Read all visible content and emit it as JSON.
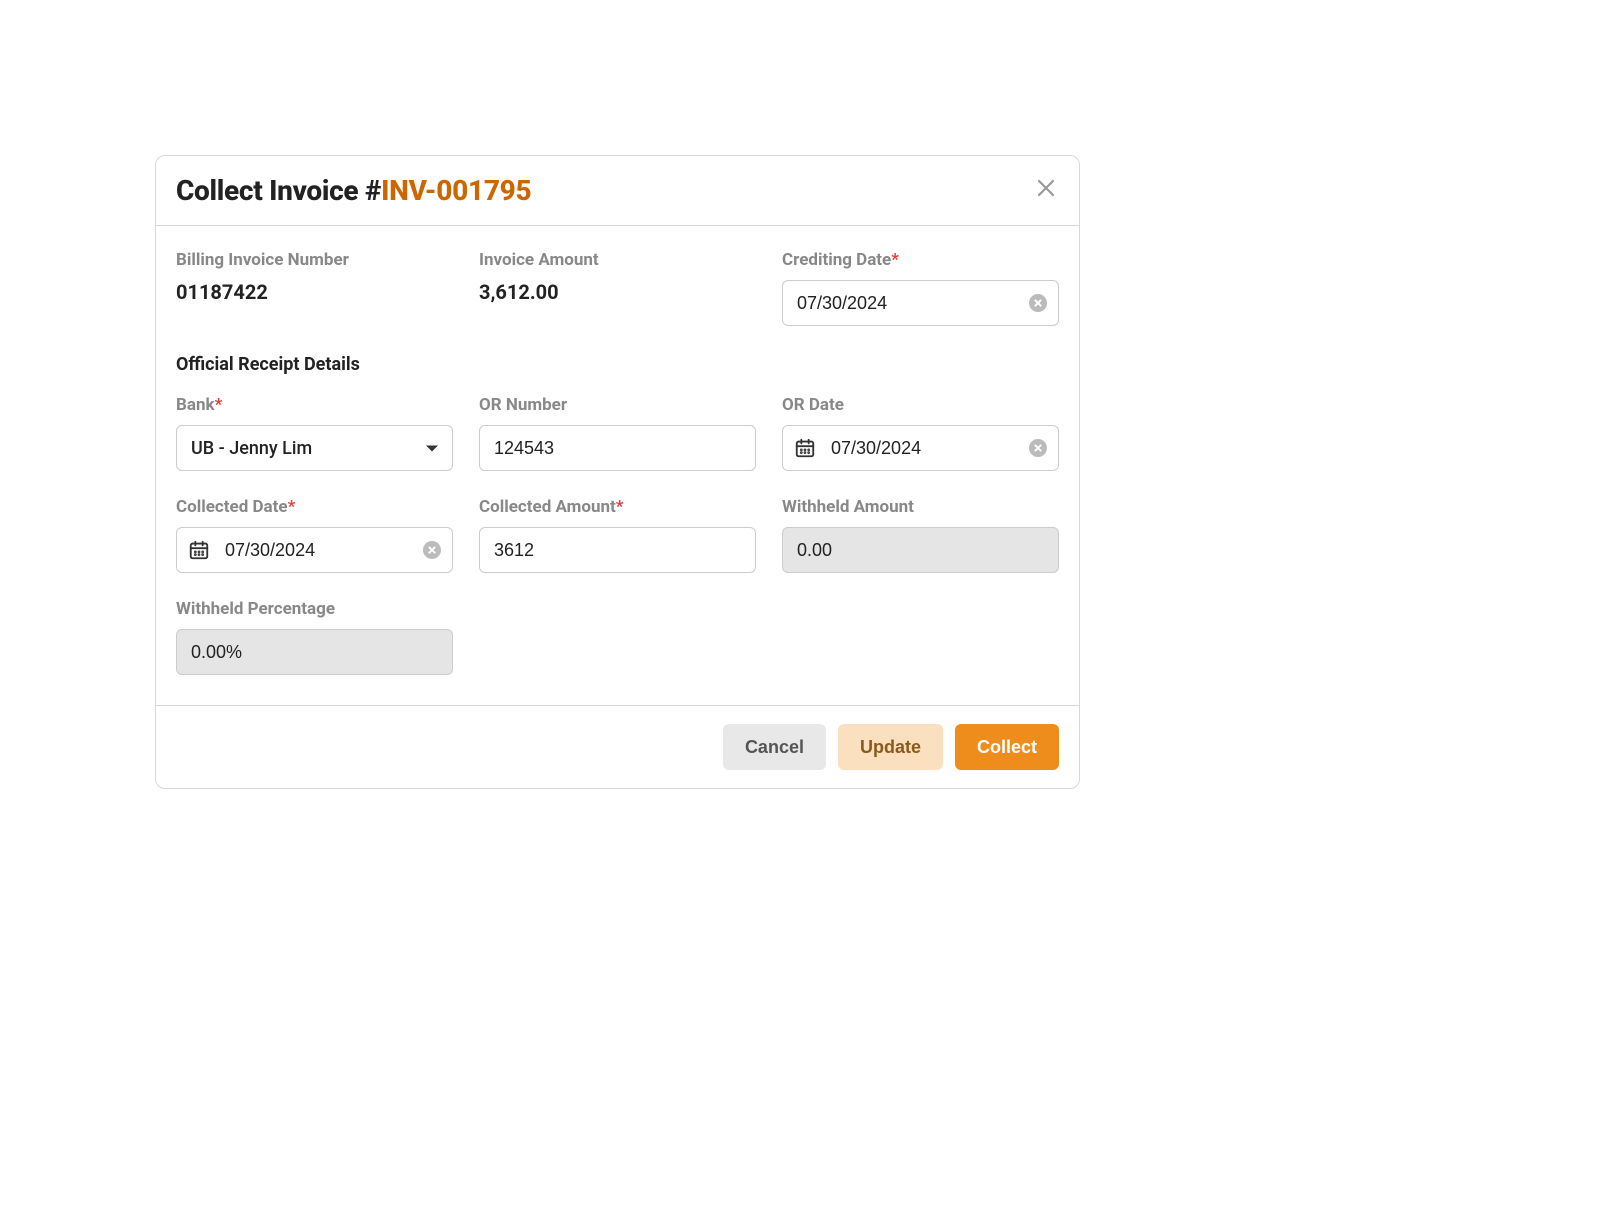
{
  "modal": {
    "title_prefix": "Collect Invoice #",
    "invoice_id": "INV-001795"
  },
  "fields": {
    "billing_invoice_number": {
      "label": "Billing Invoice Number",
      "value": "01187422"
    },
    "invoice_amount": {
      "label": "Invoice Amount",
      "value": "3,612.00"
    },
    "crediting_date": {
      "label": "Crediting Date",
      "value": "07/30/2024"
    },
    "section_or": "Official Receipt Details",
    "bank": {
      "label": "Bank",
      "value": "UB - Jenny Lim"
    },
    "or_number": {
      "label": "OR Number",
      "value": "124543"
    },
    "or_date": {
      "label": "OR Date",
      "value": "07/30/2024"
    },
    "collected_date": {
      "label": "Collected Date",
      "value": "07/30/2024"
    },
    "collected_amount": {
      "label": "Collected Amount",
      "value": "3612"
    },
    "withheld_amount": {
      "label": "Withheld Amount",
      "value": "0.00"
    },
    "withheld_percentage": {
      "label": "Withheld Percentage",
      "value": "0.00%"
    }
  },
  "buttons": {
    "cancel": "Cancel",
    "update": "Update",
    "collect": "Collect"
  }
}
